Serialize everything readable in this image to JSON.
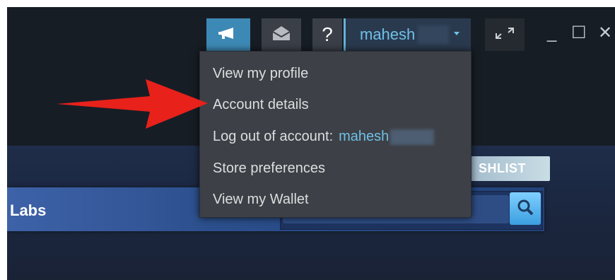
{
  "header": {
    "help_label": "?",
    "account": {
      "username": "mahesh",
      "menu_open": true
    },
    "window_controls": {
      "minimize": "_",
      "maximize": "☐",
      "close": "✕"
    }
  },
  "account_menu": {
    "items": [
      {
        "label": "View my profile"
      },
      {
        "label": "Account details"
      },
      {
        "label": "Log out of account:",
        "username": "mahesh"
      },
      {
        "label": "Store preferences"
      },
      {
        "label": "View my Wallet"
      }
    ]
  },
  "store": {
    "nav_label": "Labs",
    "wishlist_label": "SHLIST"
  },
  "annotation": {
    "arrow_color": "#e8211b",
    "points_to": "Account details"
  },
  "colors": {
    "accent": "#6fc0e8",
    "announcement_button": "#3d89b5",
    "menu_background": "#3d4046"
  }
}
